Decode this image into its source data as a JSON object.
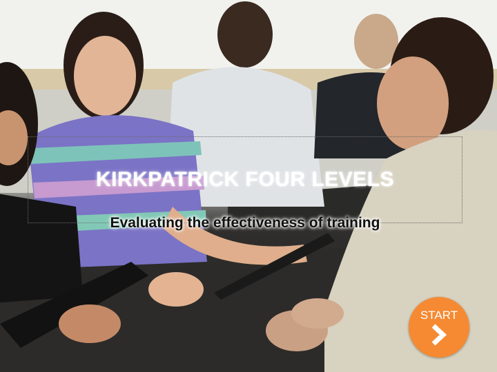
{
  "slide": {
    "title": "KIRKPATRICK FOUR LEVELS",
    "subtitle": "Evaluating the effectiveness of training"
  },
  "start_button": {
    "label": "START",
    "icon": "chevron-right-icon"
  },
  "colors": {
    "accent": "#f58a32",
    "title_text": "#ffffff",
    "subtitle_text": "#111111"
  }
}
